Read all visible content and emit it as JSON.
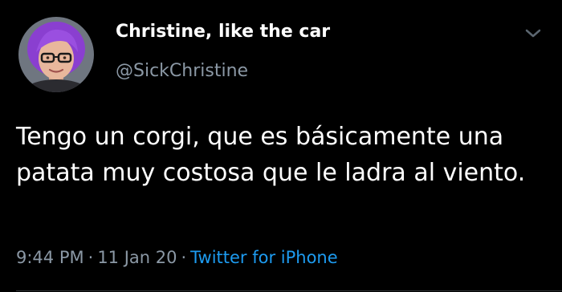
{
  "tweet": {
    "author": {
      "display_name": "Christine, like the car",
      "handle": "@SickChristine"
    },
    "text": "Tengo un corgi, que es básicamente una patata muy costosa que le ladra al viento.",
    "time": "9:44 PM",
    "separator": "·",
    "date": "11 Jan 20",
    "source": "Twitter for iPhone"
  },
  "icons": {
    "menu": "chevron-down-icon"
  },
  "colors": {
    "background": "#000000",
    "primary_text": "#ffffff",
    "secondary_text": "#8b98a5",
    "link": "#1d9bf0"
  }
}
